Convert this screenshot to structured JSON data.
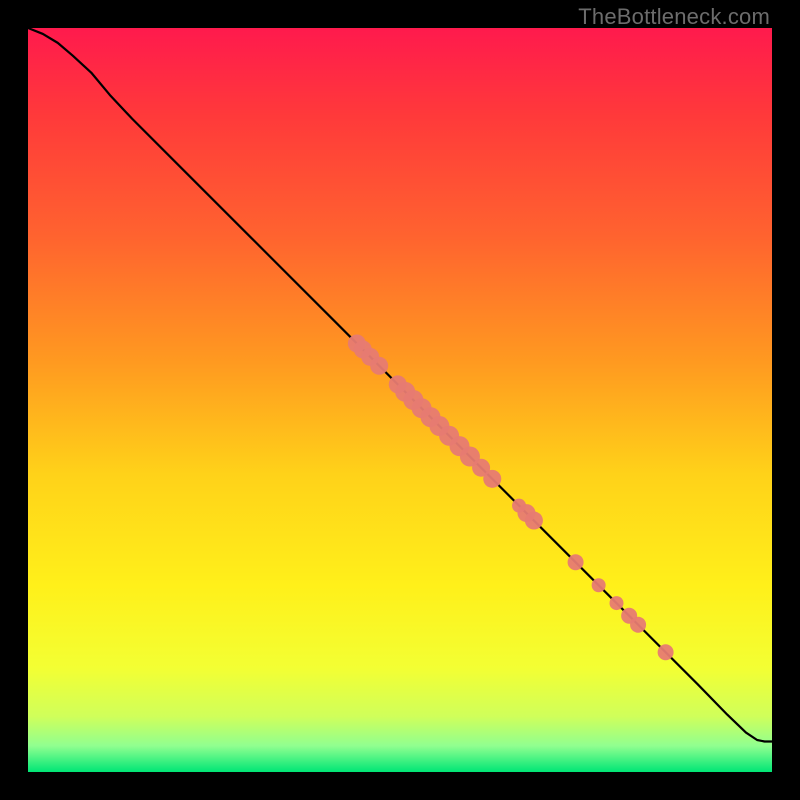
{
  "watermark": "TheBottleneck.com",
  "chart_data": {
    "type": "scatter",
    "title": "",
    "xlabel": "",
    "ylabel": "",
    "xlim": [
      0,
      100
    ],
    "ylim": [
      0,
      100
    ],
    "gradient_stops": [
      {
        "offset": 0.0,
        "color": "#ff1a4d"
      },
      {
        "offset": 0.12,
        "color": "#ff3a3a"
      },
      {
        "offset": 0.28,
        "color": "#ff632f"
      },
      {
        "offset": 0.45,
        "color": "#ff9a20"
      },
      {
        "offset": 0.6,
        "color": "#ffd219"
      },
      {
        "offset": 0.75,
        "color": "#fff01a"
      },
      {
        "offset": 0.86,
        "color": "#f3ff33"
      },
      {
        "offset": 0.925,
        "color": "#d0ff5a"
      },
      {
        "offset": 0.965,
        "color": "#90ff90"
      },
      {
        "offset": 1.0,
        "color": "#00e676"
      }
    ],
    "curve": [
      {
        "x": 0.0,
        "y": 100.0
      },
      {
        "x": 2.0,
        "y": 99.2
      },
      {
        "x": 4.0,
        "y": 98.0
      },
      {
        "x": 6.0,
        "y": 96.3
      },
      {
        "x": 8.5,
        "y": 94.0
      },
      {
        "x": 11.0,
        "y": 91.0
      },
      {
        "x": 14.0,
        "y": 87.8
      },
      {
        "x": 20.0,
        "y": 81.8
      },
      {
        "x": 30.0,
        "y": 71.8
      },
      {
        "x": 40.0,
        "y": 61.8
      },
      {
        "x": 50.0,
        "y": 51.8
      },
      {
        "x": 60.0,
        "y": 41.8
      },
      {
        "x": 70.0,
        "y": 31.8
      },
      {
        "x": 80.0,
        "y": 21.8
      },
      {
        "x": 90.0,
        "y": 11.8
      },
      {
        "x": 94.0,
        "y": 7.7
      },
      {
        "x": 96.5,
        "y": 5.3
      },
      {
        "x": 98.0,
        "y": 4.3
      },
      {
        "x": 99.0,
        "y": 4.1
      },
      {
        "x": 100.0,
        "y": 4.1
      }
    ],
    "points": [
      {
        "x": 44.2,
        "y": 57.6,
        "r": 9
      },
      {
        "x": 45.0,
        "y": 56.8,
        "r": 9
      },
      {
        "x": 46.0,
        "y": 55.8,
        "r": 9
      },
      {
        "x": 47.2,
        "y": 54.6,
        "r": 9
      },
      {
        "x": 49.7,
        "y": 52.1,
        "r": 9
      },
      {
        "x": 50.7,
        "y": 51.1,
        "r": 10
      },
      {
        "x": 51.8,
        "y": 50.0,
        "r": 10
      },
      {
        "x": 52.9,
        "y": 48.9,
        "r": 10
      },
      {
        "x": 54.1,
        "y": 47.7,
        "r": 10
      },
      {
        "x": 55.3,
        "y": 46.5,
        "r": 10
      },
      {
        "x": 56.6,
        "y": 45.2,
        "r": 10
      },
      {
        "x": 58.0,
        "y": 43.8,
        "r": 10
      },
      {
        "x": 59.4,
        "y": 42.4,
        "r": 10
      },
      {
        "x": 60.9,
        "y": 40.9,
        "r": 9
      },
      {
        "x": 62.4,
        "y": 39.4,
        "r": 9
      },
      {
        "x": 66.0,
        "y": 35.8,
        "r": 7
      },
      {
        "x": 67.0,
        "y": 34.8,
        "r": 9
      },
      {
        "x": 68.0,
        "y": 33.8,
        "r": 9
      },
      {
        "x": 73.6,
        "y": 28.2,
        "r": 8
      },
      {
        "x": 76.7,
        "y": 25.1,
        "r": 7
      },
      {
        "x": 79.1,
        "y": 22.7,
        "r": 7
      },
      {
        "x": 80.8,
        "y": 21.0,
        "r": 8
      },
      {
        "x": 82.0,
        "y": 19.8,
        "r": 8
      },
      {
        "x": 85.7,
        "y": 16.1,
        "r": 8
      }
    ],
    "point_color": "#e77b72",
    "curve_color": "#000000",
    "curve_width": 2.2,
    "green_band": {
      "from_y": 0,
      "to_y": 4.1
    }
  }
}
